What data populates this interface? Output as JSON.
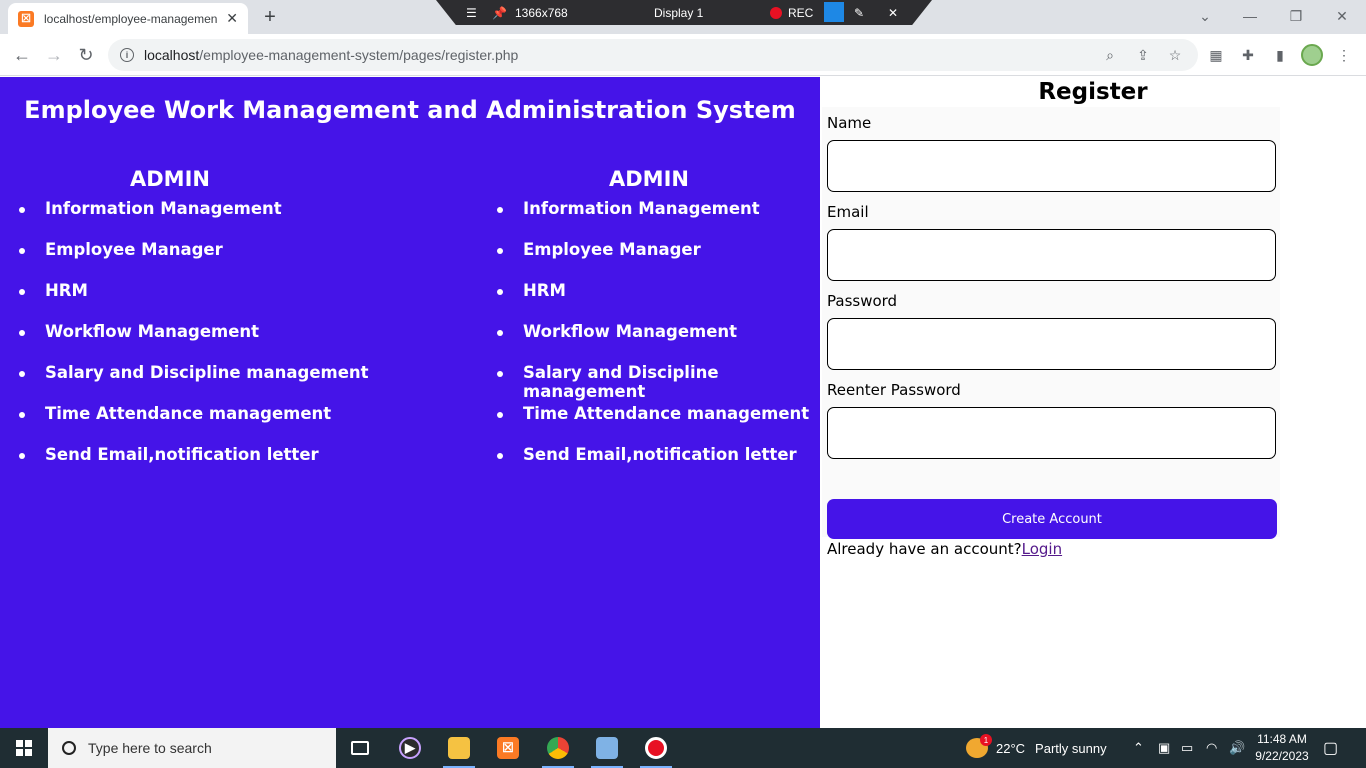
{
  "browser": {
    "tab_title": "localhost/employee-managemen",
    "url_host": "localhost",
    "url_path": "/employee-management-system/pages/register.php"
  },
  "recorder": {
    "resolution": "1366x768",
    "display": "Display 1",
    "rec_label": "REC"
  },
  "page": {
    "main_title": "Employee Work Management and Administration System",
    "columns": [
      {
        "heading": "ADMIN",
        "items": [
          "Information Management",
          "Employee Manager",
          "HRM",
          "Workflow Management",
          "Salary and Discipline management",
          "Time Attendance management",
          "Send Email,notification letter"
        ]
      },
      {
        "heading": "ADMIN",
        "items": [
          "Information Management",
          "Employee Manager",
          "HRM",
          "Workflow Management",
          "Salary and Discipline management",
          "Time Attendance management",
          "Send Email,notification letter"
        ]
      }
    ],
    "colors": {
      "accent": "#4514e8"
    }
  },
  "form": {
    "title": "Register",
    "name_label": "Name",
    "email_label": "Email",
    "password_label": "Password",
    "reenter_label": "Reenter Password",
    "name_value": "",
    "email_value": "",
    "password_value": "",
    "reenter_value": "",
    "submit_label": "Create Account",
    "login_prompt": "Already have an account?",
    "login_link": "Login"
  },
  "taskbar": {
    "search_placeholder": "Type here to search",
    "weather_temp": "22°C",
    "weather_desc": "Partly sunny",
    "weather_badge": "1",
    "time": "11:48 AM",
    "date": "9/22/2023"
  }
}
